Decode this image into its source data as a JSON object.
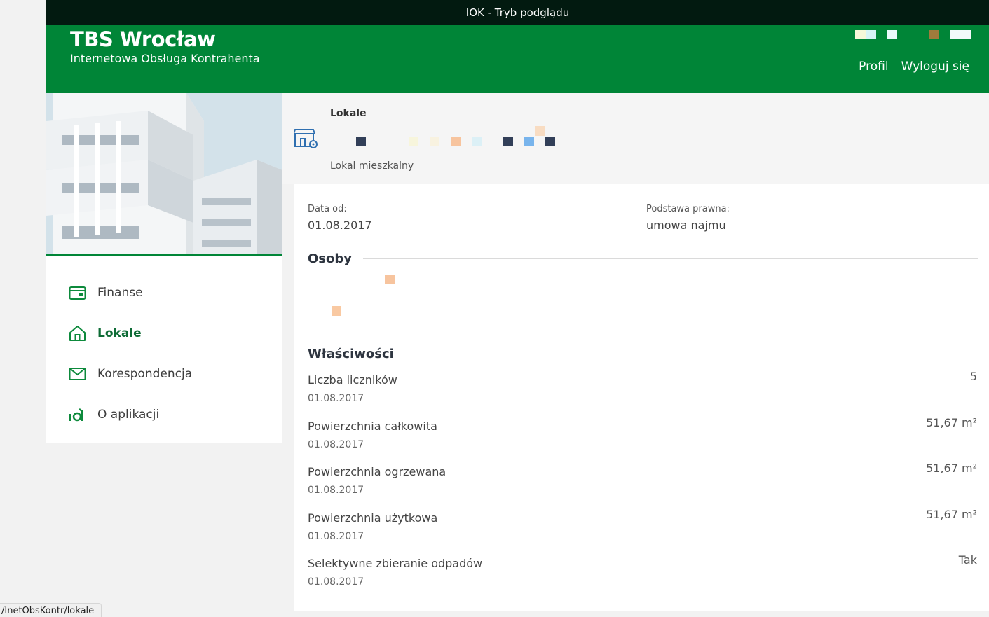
{
  "window": {
    "title": "IOK - Tryb podglądu"
  },
  "header": {
    "brand": "TBS Wrocław",
    "subtitle": "Internetowa Obsługa Kontrahenta",
    "nav": {
      "profile": "Profil",
      "logout": "Wyloguj się"
    },
    "accent_color": "#008537"
  },
  "sidebar": {
    "items": [
      {
        "label": "Finanse",
        "icon": "wallet-icon",
        "active": false
      },
      {
        "label": "Lokale",
        "icon": "home-icon",
        "active": true
      },
      {
        "label": "Korespondencja",
        "icon": "envelope-icon",
        "active": false
      },
      {
        "label": "O aplikacji",
        "icon": "info-app-icon",
        "active": false
      }
    ]
  },
  "lokal": {
    "section_title": "Lokale",
    "type": "Lokal mieszkalny",
    "icon": "building-location-icon"
  },
  "details": {
    "date_from_label": "Data od:",
    "date_from_value": "01.08.2017",
    "legal_basis_label": "Podstawa prawna:",
    "legal_basis_value": "umowa najmu"
  },
  "persons": {
    "title": "Osoby"
  },
  "properties": {
    "title": "Właściwości",
    "items": [
      {
        "name": "Liczba liczników",
        "date": "01.08.2017",
        "value": "5"
      },
      {
        "name": "Powierzchnia całkowita",
        "date": "01.08.2017",
        "value": "51,67 m²"
      },
      {
        "name": "Powierzchnia ogrzewana",
        "date": "01.08.2017",
        "value": "51,67 m²"
      },
      {
        "name": "Powierzchnia użytkowa",
        "date": "01.08.2017",
        "value": "51,67 m²"
      },
      {
        "name": "Selektywne zbieranie odpadów",
        "date": "01.08.2017",
        "value": "Tak"
      }
    ]
  },
  "status_bar": {
    "url": "/InetObsKontr/lokale"
  }
}
